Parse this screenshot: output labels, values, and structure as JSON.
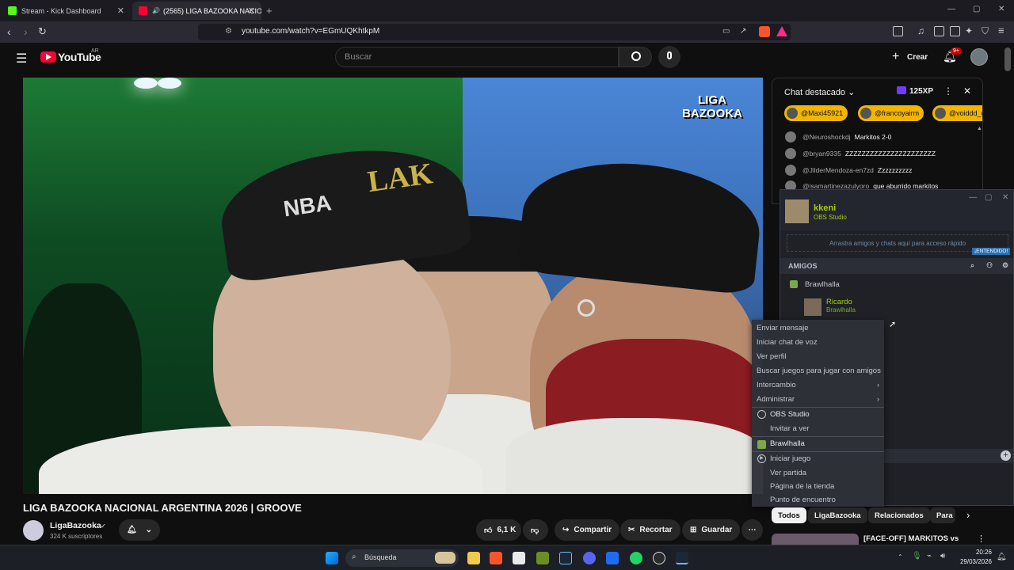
{
  "browser": {
    "tabs": [
      {
        "title": "Stream - Kick Dashboard",
        "active": false
      },
      {
        "title": "(2565) LIGA BAZOOKA NACIO",
        "active": true
      }
    ],
    "new_tab": "+",
    "url": "youtube.com/watch?v=EGmUQKhtkpM",
    "window_controls": [
      "—",
      "▢",
      "✕"
    ]
  },
  "youtube": {
    "logo_text": "YouTube",
    "country": "AR",
    "search_placeholder": "Buscar",
    "create_label": "Crear",
    "notifications_badge": "9+"
  },
  "video": {
    "overlay_logo_line1": "LIGA",
    "overlay_logo_line2": "BAZOOKA",
    "title": "LIGA BAZOOKA NACIONAL ARGENTINA 2026 | GROOVE",
    "channel": "LigaBazooka",
    "subscribers": "324 K suscriptores",
    "likes": "6,1 K",
    "share_label": "Compartir",
    "clip_label": "Recortar",
    "save_label": "Guardar"
  },
  "chat": {
    "title": "Chat destacado",
    "xp": "125XP",
    "chips": [
      "@Maxi45921",
      "@francoyairm",
      "@voiddd_d"
    ],
    "messages": [
      {
        "user": "@Neuroshockdj",
        "text": "Markitos 2-0"
      },
      {
        "user": "@bryan9335",
        "text": "ZZZZZZZZZZZZZZZZZZZZZZ"
      },
      {
        "user": "@JilderMendoza-en7zd",
        "text": "Zzzzzzzzzz"
      },
      {
        "user": "@isamartinezazulyoro",
        "text": "que aburrido markitos"
      }
    ]
  },
  "steam": {
    "username": "kkeni",
    "status": "OBS Studio",
    "drag_hint": "Arrastra amigos y chats aquí para acceso rápido",
    "understood": "¡ENTENDIDO!",
    "friends_header": "AMIGOS",
    "group": "Brawlhalla",
    "friend_name": "Ricardo",
    "friend_game": "Brawlhalla"
  },
  "context_menu": {
    "items": [
      "Enviar mensaje",
      "Iniciar chat de voz",
      "Ver perfil",
      "Buscar juegos para jugar con amigos",
      "Intercambio",
      "Administrar"
    ],
    "obs_section": "OBS Studio",
    "invite": "Invitar a ver",
    "game_section": "Brawlhalla",
    "game_items": [
      "Iniciar juego",
      "Ver partida",
      "Página de la tienda",
      "Punto de encuentro"
    ]
  },
  "filter_tabs": [
    "Todos",
    "LigaBazooka",
    "Relacionados",
    "Para"
  ],
  "recommended": {
    "title": "[FACE-OFF] MARKITOS vs"
  },
  "taskbar": {
    "search_label": "Búsqueda",
    "time": "20:26",
    "date": "29/03/2026"
  },
  "colors": {
    "yt_red": "#ff0033",
    "chip_yellow": "#f2b600",
    "steam_green": "#a4d007",
    "xp_purple": "#6f3cff"
  }
}
